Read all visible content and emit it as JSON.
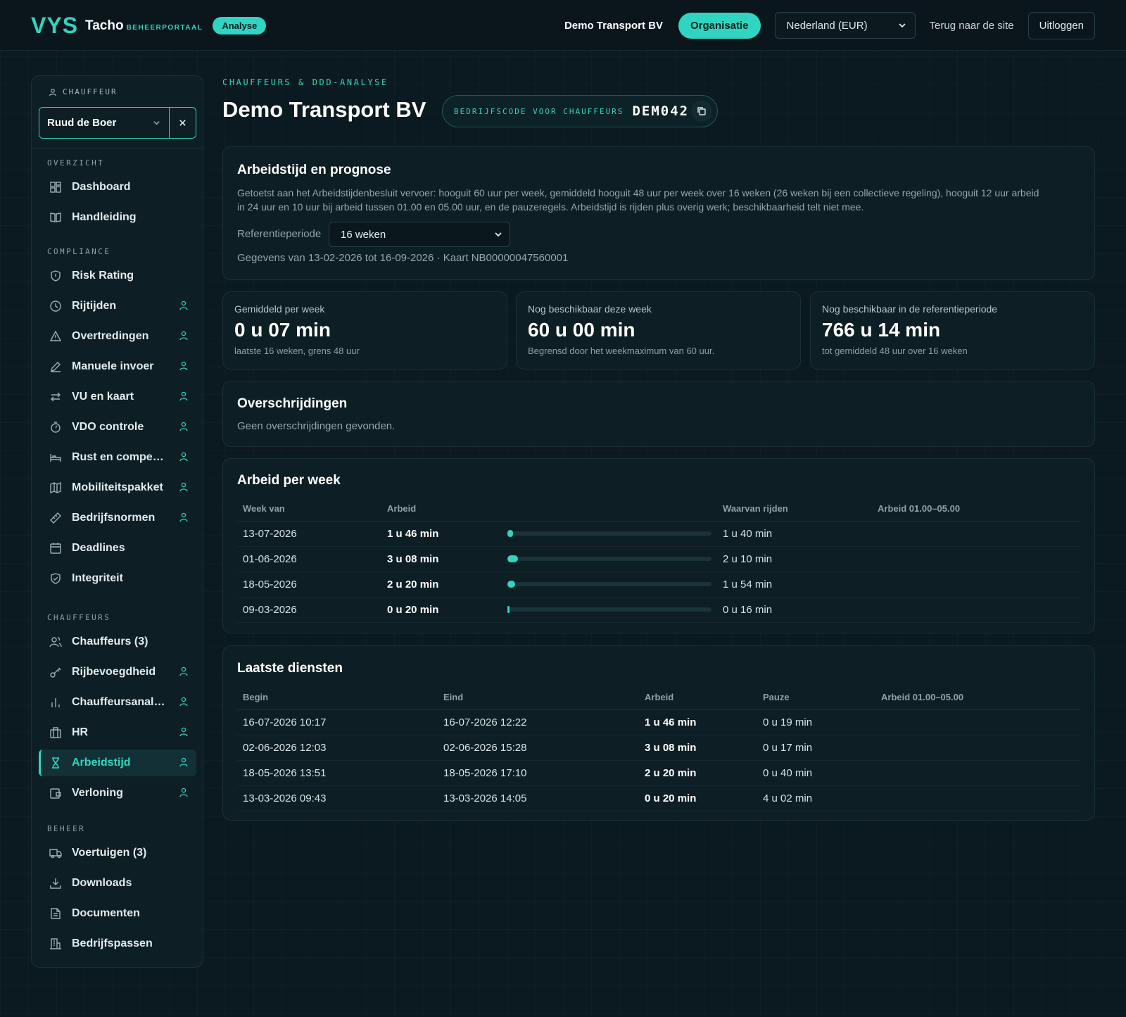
{
  "topbar": {
    "logo_mark": "VYS",
    "logo_name": "Tacho",
    "logo_sub": "BEHEERPORTAAL",
    "badge": "Analyse",
    "org_name": "Demo Transport BV",
    "org_button": "Organisatie",
    "country_select": "Nederland (EUR)",
    "back_link": "Terug naar de site",
    "logout": "Uitloggen"
  },
  "sidebar": {
    "driver_label": "CHAUFFEUR",
    "driver_value": "Ruud de Boer",
    "sections": {
      "overview": "OVERZICHT",
      "compliance": "COMPLIANCE",
      "drivers": "CHAUFFEURS",
      "admin": "BEHEER"
    },
    "items": {
      "dashboard": "Dashboard",
      "manual": "Handleiding",
      "risk": "Risk Rating",
      "driving": "Rijtijden",
      "violations": "Overtredingen",
      "manual_input": "Manuele invoer",
      "vu_card": "VU en kaart",
      "vdo": "VDO controle",
      "rest": "Rust en compensatie",
      "mobility": "Mobiliteitspakket",
      "norms": "Bedrijfsnormen",
      "deadlines": "Deadlines",
      "integrity": "Integriteit",
      "drivers": "Chauffeurs (3)",
      "license": "Rijbevoegdheid",
      "analysis": "Chauffeursanalyse",
      "hr": "HR",
      "worktime": "Arbeidstijd",
      "payroll": "Verloning",
      "vehicles": "Voertuigen (3)",
      "downloads": "Downloads",
      "documents": "Documenten",
      "cards": "Bedrijfspassen"
    }
  },
  "header": {
    "eyebrow": "CHAUFFEURS & DDD-ANALYSE",
    "title": "Demo Transport BV",
    "code_label": "BEDRIJFSCODE VOOR CHAUFFEURS",
    "code_value": "DEM042"
  },
  "forecast": {
    "title": "Arbeidstijd en prognose",
    "description_1": "Getoetst aan het Arbeidstijdenbesluit vervoer: hooguit 60 uur per week, gemiddeld hooguit 48 uur per week over 16 weken (26 weken bij een collectieve regeling), hooguit 12 uur arbeid",
    "description_2": "in 24 uur en 10 uur bij arbeid tussen 01.00 en 05.00 uur, en de pauzeregels. Arbeidstijd is rijden plus overig werk; beschikbaarheid telt niet mee.",
    "period_label": "Referentieperiode",
    "period_value": "16 weken",
    "data_range": "Gegevens van 13-02-2026 tot 16-09-2026 · Kaart NB00000047560001"
  },
  "stats": [
    {
      "title": "Gemiddeld per week",
      "value": "0 u 07 min",
      "sub": "laatste 16 weken, grens 48 uur"
    },
    {
      "title": "Nog beschikbaar deze week",
      "value": "60 u 00 min",
      "sub": "Begrensd door het weekmaximum van 60 uur."
    },
    {
      "title": "Nog beschikbaar in de referentieperiode",
      "value": "766 u 14 min",
      "sub": "tot gemiddeld 48 uur over 16 weken"
    }
  ],
  "exceed": {
    "title": "Overschrijdingen",
    "empty": "Geen overschrijdingen gevonden."
  },
  "weekly": {
    "title": "Arbeid per week",
    "headers": [
      "Week van",
      "Arbeid",
      "Waarvan rijden",
      "Arbeid 01.00–05.00"
    ],
    "rows": [
      {
        "week": "13-07-2026",
        "work": "1 u 46 min",
        "drive": "1 u 40 min",
        "night": "",
        "fill": 0.029
      },
      {
        "week": "01-06-2026",
        "work": "3 u 08 min",
        "drive": "2 u 10 min",
        "night": "",
        "fill": 0.052
      },
      {
        "week": "18-05-2026",
        "work": "2 u 20 min",
        "drive": "1 u 54 min",
        "night": "",
        "fill": 0.039
      },
      {
        "week": "09-03-2026",
        "work": "0 u 20 min",
        "drive": "0 u 16 min",
        "night": "",
        "fill": 0.006
      }
    ]
  },
  "shifts": {
    "title": "Laatste diensten",
    "headers": [
      "Begin",
      "Eind",
      "Arbeid",
      "Pauze",
      "Arbeid 01.00–05.00"
    ],
    "rows": [
      {
        "begin": "16-07-2026 10:17",
        "end": "16-07-2026 12:22",
        "work": "1 u 46 min",
        "pause": "0 u 19 min",
        "night": ""
      },
      {
        "begin": "02-06-2026 12:03",
        "end": "02-06-2026 15:28",
        "work": "3 u 08 min",
        "pause": "0 u 17 min",
        "night": ""
      },
      {
        "begin": "18-05-2026 13:51",
        "end": "18-05-2026 17:10",
        "work": "2 u 20 min",
        "pause": "0 u 40 min",
        "night": ""
      },
      {
        "begin": "13-03-2026 09:43",
        "end": "13-03-2026 14:05",
        "work": "0 u 20 min",
        "pause": "4 u 02 min",
        "night": ""
      }
    ]
  },
  "colors": {
    "accent": "#2fd5c0",
    "background": "#0b1a20",
    "card": "#0d1e24"
  }
}
